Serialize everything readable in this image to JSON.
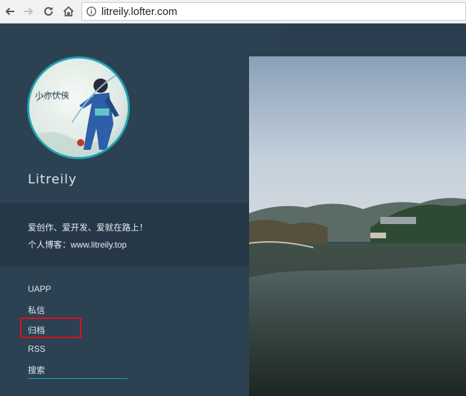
{
  "browser": {
    "url": "litreily.lofter.com",
    "icons": [
      "back-arrow-icon",
      "forward-arrow-icon",
      "reload-icon",
      "home-icon",
      "info-icon"
    ]
  },
  "profile": {
    "blog_name": "Litreily",
    "avatar_text": "小亦伏侠"
  },
  "description": {
    "line1": "爱创作、爱开发、爱就在路上！",
    "line2": "个人博客：www.litreily.top"
  },
  "menu": {
    "items": [
      "UAPP",
      "私信",
      "归档",
      "RSS",
      "搜索"
    ],
    "highlighted": "归档"
  },
  "colors": {
    "sidebar": "#2c4152",
    "accent": "#1fa2b3",
    "highlight": "#e0101b"
  }
}
